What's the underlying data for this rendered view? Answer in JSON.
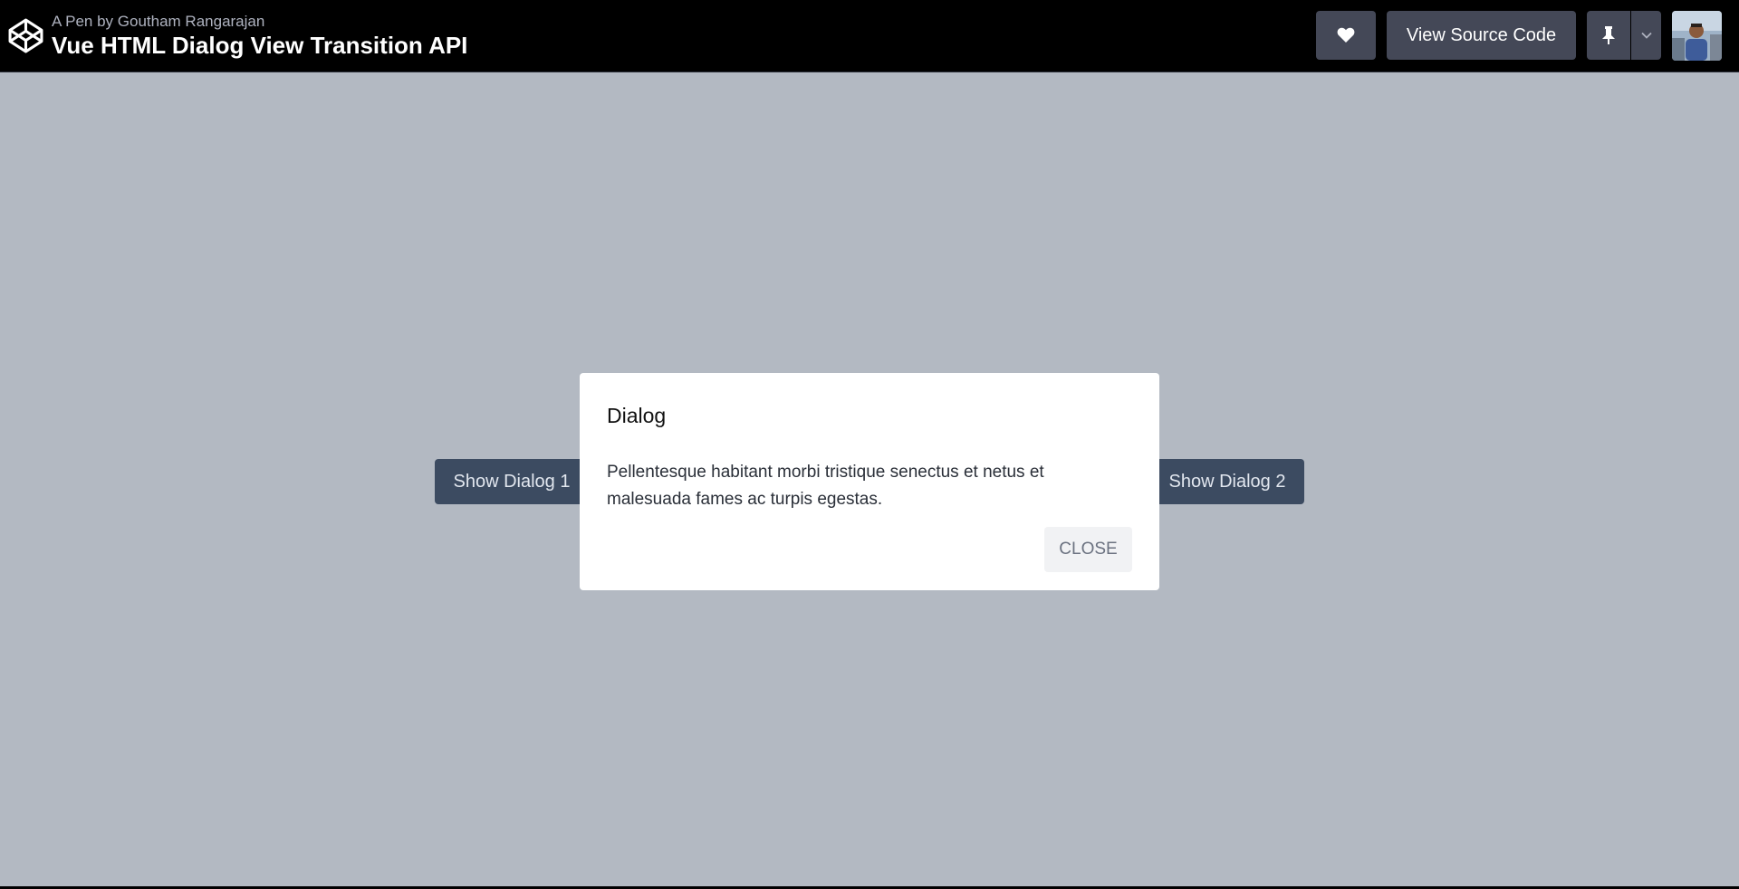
{
  "header": {
    "byline": "A Pen by Goutham Rangarajan",
    "title": "Vue HTML Dialog View Transition API",
    "source_button": "View Source Code",
    "icons": {
      "logo": "codepen-logo-icon",
      "heart": "heart-icon",
      "pin": "pin-icon",
      "dropdown": "chevron-down-icon"
    }
  },
  "main": {
    "show_dialog_1": "Show Dialog 1",
    "show_dialog_2": "Show Dialog 2"
  },
  "dialog": {
    "title": "Dialog",
    "body": "Pellentesque habitant morbi tristique senectus et netus et malesuada fames ac turpis egestas.",
    "close_label": "CLOSE"
  },
  "colors": {
    "topbar": "#000000",
    "stage_background": "#b3b9c2",
    "header_button": "#444857",
    "show_button": "#3c4b61",
    "dialog_background": "#ffffff",
    "close_button": "#f1f2f4"
  }
}
